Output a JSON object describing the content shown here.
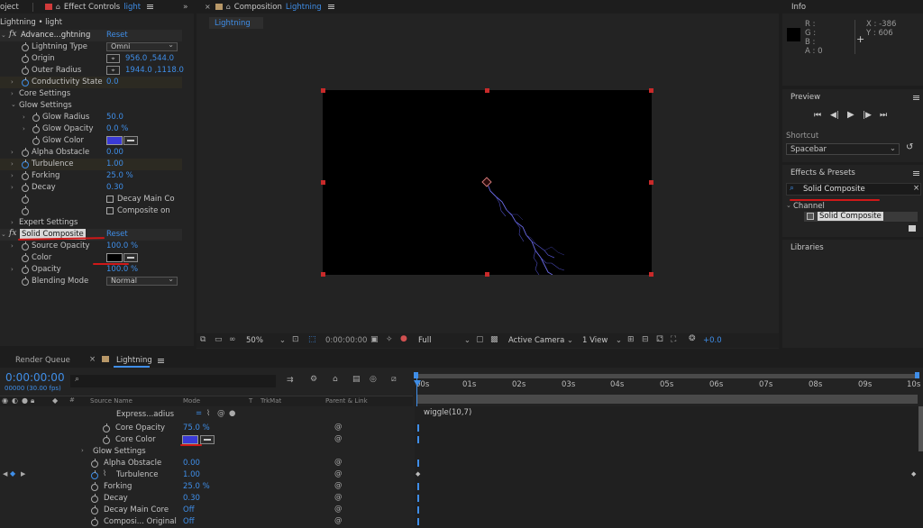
{
  "effect_controls": {
    "tab_project": "oject",
    "tab_label": "Effect Controls",
    "tab_layer": "light",
    "breadcrumb": "Lightning • light",
    "effect1": {
      "name": "Advance...ghtning",
      "reset": "Reset"
    },
    "lightning_type": {
      "label": "Lightning Type",
      "value": "Omni"
    },
    "origin": {
      "label": "Origin",
      "value": "956.0 ,544.0"
    },
    "outer_radius": {
      "label": "Outer Radius",
      "value": "1944.0 ,1118.0"
    },
    "conductivity": {
      "label": "Conductivity State",
      "value": "0.0"
    },
    "core_settings": "Core Settings",
    "glow_settings": "Glow Settings",
    "glow_radius": {
      "label": "Glow Radius",
      "value": "50.0"
    },
    "glow_opacity": {
      "label": "Glow Opacity",
      "value": "0.0 %"
    },
    "glow_color": {
      "label": "Glow Color",
      "color": "#3a3ad6"
    },
    "alpha_obstacle": {
      "label": "Alpha Obstacle",
      "value": "0.00"
    },
    "turbulence": {
      "label": "Turbulence",
      "value": "1.00"
    },
    "forking": {
      "label": "Forking",
      "value": "25.0 %"
    },
    "decay": {
      "label": "Decay",
      "value": "0.30"
    },
    "decay_main": "Decay Main Co",
    "composite_on": "Composite on",
    "expert_settings": "Expert Settings",
    "effect2": {
      "name": "Solid Composite",
      "reset": "Reset"
    },
    "source_opacity": {
      "label": "Source Opacity",
      "value": "100.0 %"
    },
    "color": {
      "label": "Color",
      "color": "#000000"
    },
    "opacity": {
      "label": "Opacity",
      "value": "100.0 %"
    },
    "blending_mode": {
      "label": "Blending Mode",
      "value": "Normal"
    }
  },
  "composition": {
    "tab_label": "Composition",
    "comp_name": "Lightning",
    "subtab": "Lightning",
    "toolbar": {
      "zoom": "50%",
      "timecode": "0:00:00:00",
      "resolution": "Full",
      "camera": "Active Camera",
      "views": "1 View",
      "exposure": "+0.0"
    }
  },
  "info": {
    "title": "Info",
    "r": "R :",
    "g": "G :",
    "b": "B :",
    "a": "A : 0",
    "x": "X : -386",
    "y": "Y :  606"
  },
  "preview": {
    "title": "Preview",
    "shortcut_label": "Shortcut",
    "shortcut_value": "Spacebar"
  },
  "effects_presets": {
    "title": "Effects & Presets",
    "search_value": "Solid Composite",
    "category": "Channel",
    "item": "Solid Composite"
  },
  "libraries": {
    "title": "Libraries"
  },
  "timeline": {
    "tab_render_queue": "Render Queue",
    "tab_comp": "Lightning",
    "timecode": "0:00:00:00",
    "fps": "00000 (30.00 fps)",
    "columns": {
      "source_name": "Source Name",
      "mode": "Mode",
      "t": "T",
      "trkmat": "TrkMat",
      "parent": "Parent & Link"
    },
    "ruler": [
      "00s",
      "01s",
      "02s",
      "03s",
      "04s",
      "05s",
      "06s",
      "07s",
      "08s",
      "09s",
      "10s"
    ],
    "expression_text": "wiggle(10,7)",
    "rows": [
      {
        "label": "Express...adius"
      },
      {
        "label": "Core Opacity",
        "value": "75.0 %"
      },
      {
        "label": "Core Color",
        "color": "#3a3ad6"
      },
      {
        "label": "Glow Settings"
      },
      {
        "label": "Alpha Obstacle",
        "value": "0.00"
      },
      {
        "label": "Turbulence",
        "value": "1.00"
      },
      {
        "label": "Forking",
        "value": "25.0 %"
      },
      {
        "label": "Decay",
        "value": "0.30"
      },
      {
        "label": "Decay Main Core",
        "value": "Off"
      },
      {
        "label": "Composi... Original",
        "value": "Off"
      }
    ]
  },
  "colors": {
    "accent": "#3f8ee8",
    "handle": "#c82a2a",
    "annotation": "#d01818"
  }
}
